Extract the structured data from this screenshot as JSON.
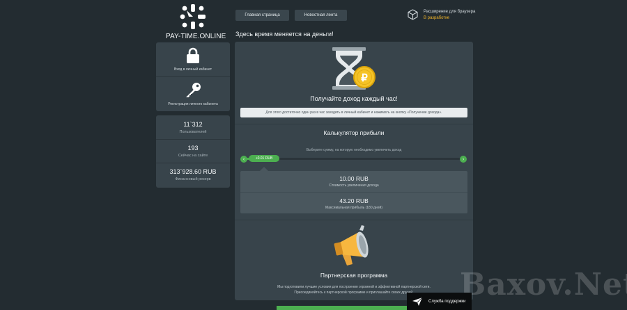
{
  "brand": {
    "name": "PAY-TIME.ONLINE",
    "accent": "#4caf50",
    "warning": "#f0b429"
  },
  "nav": [
    {
      "label": "Главная страница"
    },
    {
      "label": "Новостная лента"
    }
  ],
  "tagline": "Здесь время меняется на деньги!",
  "extension": {
    "title": "Расширение для браузера",
    "status": "В разработке",
    "icon": "cube-icon"
  },
  "sidebar": {
    "login": {
      "label": "Вход в личный кабинет",
      "icon": "lock-icon"
    },
    "register": {
      "label": "Регистрация личного кабинета",
      "icon": "key-icon"
    }
  },
  "stats": [
    {
      "value": "11`312",
      "label": "Пользователей"
    },
    {
      "value": "193",
      "label": "Сейчас на сайте"
    },
    {
      "value": "313`928.60 RUB",
      "label": "Финансовый резерв"
    }
  ],
  "hero": {
    "title": "Получайте доход каждый час!",
    "info": "Для этого достаточно один раз в час заходить в личный кабинет и нажимать на кнопку «Получение дохода».",
    "icon": "hourglass-coin-icon"
  },
  "calculator": {
    "title": "Калькулятор прибыли",
    "hint": "Выберите сумму, на которую необходимо увеличить доход",
    "slider_value": "+0.01 RUB",
    "slider_fraction": 0.0,
    "prev": "‹",
    "next": "›",
    "results": [
      {
        "value": "10.00 RUB",
        "label": "Стоимость увеличения дохода"
      },
      {
        "value": "43.20 RUB",
        "label": "Максимальная прибыль (180 дней)"
      }
    ]
  },
  "partner": {
    "title": "Партнерская программа",
    "text1": "Мы подготовили лучшие условия для построения огромной и эффективной партнерской сети.",
    "text2": "Присоединяйтесь к партнерской программе и приглашайте своих друзей.",
    "icon": "megaphone-icon"
  },
  "support": {
    "label": "Служба поддержки",
    "icon": "paper-plane-icon"
  },
  "watermark": "Baxov.Net"
}
